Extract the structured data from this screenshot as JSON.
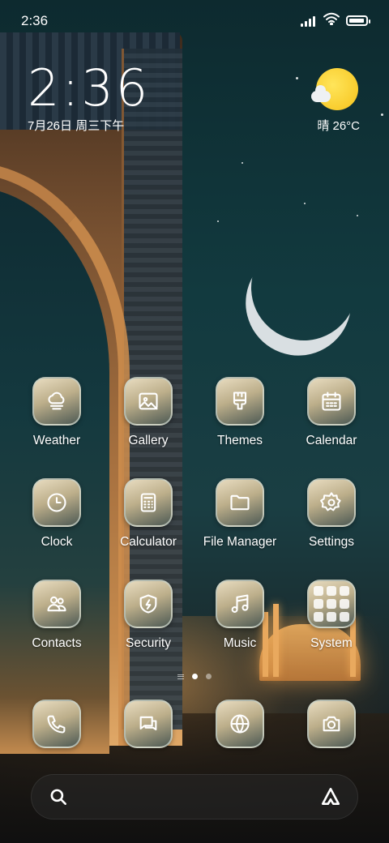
{
  "status_bar": {
    "time": "2:36",
    "icons": [
      "cellular-signal-icon",
      "wifi-icon",
      "battery-icon"
    ],
    "battery_level": 0.85
  },
  "clock_widget": {
    "time": "2:36",
    "date": "7月26日 周三下午"
  },
  "weather_widget": {
    "icon": "sunny-cloud-icon",
    "condition_and_temp": "晴 26°C"
  },
  "apps": [
    {
      "label": "Weather",
      "icon": "weather-icon"
    },
    {
      "label": "Gallery",
      "icon": "gallery-icon"
    },
    {
      "label": "Themes",
      "icon": "themes-brush-icon"
    },
    {
      "label": "Calendar",
      "icon": "calendar-icon"
    },
    {
      "label": "Clock",
      "icon": "clock-icon"
    },
    {
      "label": "Calculator",
      "icon": "calculator-icon"
    },
    {
      "label": "File Manager",
      "icon": "folder-icon"
    },
    {
      "label": "Settings",
      "icon": "gear-icon"
    },
    {
      "label": "Contacts",
      "icon": "contacts-icon"
    },
    {
      "label": "Security",
      "icon": "shield-icon"
    },
    {
      "label": "Music",
      "icon": "music-note-icon"
    },
    {
      "label": "System",
      "icon": "app-folder-icon"
    }
  ],
  "page_indicator": {
    "pages": 2,
    "active_page": 1
  },
  "dock": [
    {
      "icon": "phone-icon"
    },
    {
      "icon": "messages-icon"
    },
    {
      "icon": "browser-globe-icon"
    },
    {
      "icon": "camera-icon"
    }
  ],
  "search_bar": {
    "left_icon": "search-icon",
    "right_icon": "assistant-icon"
  },
  "colors": {
    "icon_gradient_top": "#e8dcc0",
    "icon_gradient_bottom": "#4e5a54",
    "sun": "#f6c21b",
    "sky": "#123a3f"
  }
}
